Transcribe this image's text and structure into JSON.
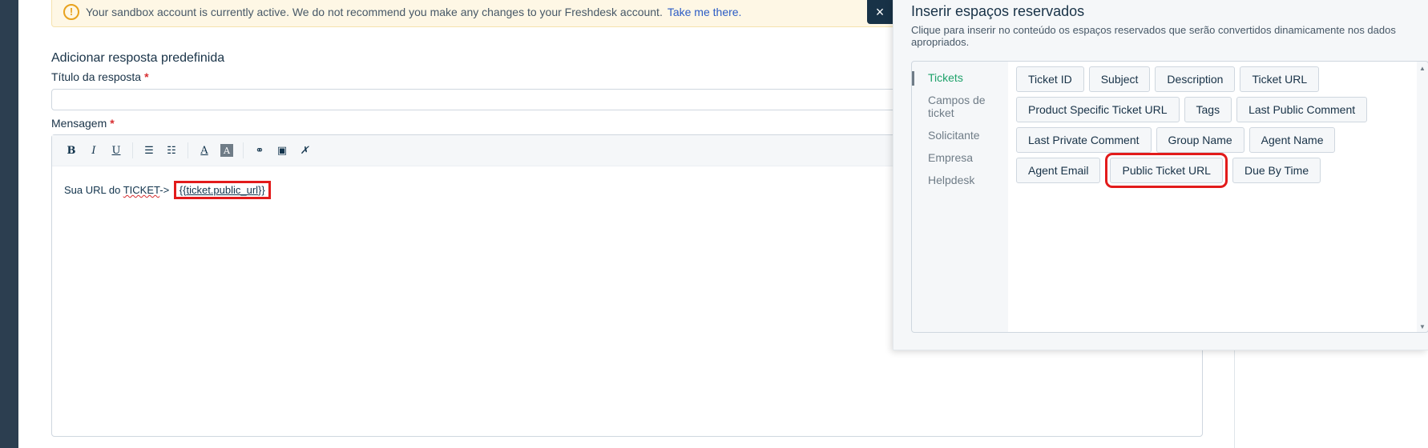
{
  "banner": {
    "icon": "warning-icon",
    "text": "Your sandbox account is currently active. We do not recommend you make any changes to your Freshdesk account.",
    "link": "Take me there."
  },
  "form": {
    "section_title": "Adicionar resposta predefinida",
    "title_label": "Título da resposta",
    "message_label": "Mensagem",
    "required_mark": "*",
    "title_value": ""
  },
  "toolbar": {
    "bold": "B",
    "italic": "I",
    "underline": "U",
    "bullets": "☰",
    "numbers": "☷",
    "font_color": "A",
    "bg_color": "A",
    "link": "⚭",
    "image": "▣",
    "clear": "✗"
  },
  "editor": {
    "text_prefix": "Sua URL do ",
    "text_word": "TICKET",
    "text_arrow": "-> ",
    "placeholder": "{{ticket.public_url}}"
  },
  "popup": {
    "close": "×",
    "title": "Inserir espaços reservados",
    "description": "Clique para inserir no conteúdo os espaços reservados que serão convertidos dinamicamente nos dados apropriados.",
    "categories": [
      "Tickets",
      "Campos de ticket",
      "Solicitante",
      "Empresa",
      "Helpdesk"
    ],
    "active_category": "Tickets",
    "rows": [
      [
        "Ticket ID",
        "Subject",
        "Description",
        "Ticket URL"
      ],
      [
        "Product Specific Ticket URL",
        "Tags",
        "Last Public Comment"
      ],
      [
        "Last Private Comment",
        "Group Name",
        "Agent Name"
      ],
      [
        "Agent Email",
        "Public Ticket URL",
        "Due By Time"
      ]
    ],
    "highlighted": "Public Ticket URL"
  },
  "colors": {
    "accent_green": "#1fa26b",
    "highlight_red": "#e21b1b",
    "banner_bg": "#fef7e5",
    "link_blue": "#2c5cc5"
  }
}
